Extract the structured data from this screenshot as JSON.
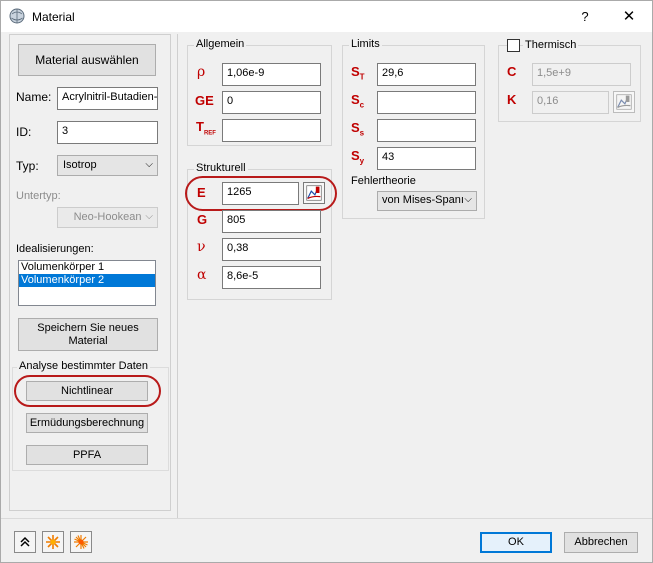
{
  "window": {
    "title": "Material",
    "help_label": "?",
    "close_label": "✕"
  },
  "left": {
    "select_material_label": "Material auswählen",
    "name_label": "Name:",
    "name_value": "Acrylnitril-Butadien-",
    "id_label": "ID:",
    "id_value": "3",
    "type_label": "Typ:",
    "type_value": "Isotrop",
    "subtype_label": "Untertyp:",
    "subtype_value": "Neo-Hookean",
    "idealizations_label": "Idealisierungen:",
    "idealizations": [
      "Volumenkörper 1",
      "Volumenkörper 2"
    ],
    "save_material_label": "Speichern Sie neues Material",
    "analysis_group_title": "Analyse bestimmter Daten",
    "nonlinear_label": "Nichtlinear",
    "fatigue_label": "Ermüdungsberechnung",
    "ppfa_label": "PPFA"
  },
  "allgemein": {
    "title": "Allgemein",
    "rho_symbol": "ρ",
    "rho_value": "1,06e-9",
    "ge_symbol": "GE",
    "ge_value": "0",
    "tref_symbol": "T",
    "tref_sub": "REF",
    "tref_value": ""
  },
  "strukturell": {
    "title": "Strukturell",
    "e_symbol": "E",
    "e_value": "1265",
    "g_symbol": "G",
    "g_value": "805",
    "nu_symbol": "ν",
    "nu_value": "0,38",
    "alpha_symbol": "α",
    "alpha_value": "8,6e-5"
  },
  "limits": {
    "title": "Limits",
    "st_symbol": "S",
    "st_sub": "T",
    "st_value": "29,6",
    "sc_symbol": "S",
    "sc_sub": "c",
    "sc_value": "",
    "ss_symbol": "S",
    "ss_sub": "s",
    "ss_value": "",
    "sy_symbol": "S",
    "sy_sub": "y",
    "sy_value": "43",
    "failure_theory_label": "Fehlertheorie",
    "failure_theory_value": "von Mises-Spanı"
  },
  "thermisch": {
    "title": "Thermisch",
    "checked": false,
    "c_symbol": "C",
    "c_value": "1,5e+9",
    "k_symbol": "K",
    "k_value": "0,16"
  },
  "footer": {
    "ok_label": "OK",
    "cancel_label": "Abbrechen"
  },
  "icons": {
    "app": "material-sphere-icon",
    "chart": "stress-strain-chart-icon",
    "collapse": "double-chevron-up-icon",
    "star1": "orange-star-icon",
    "star2": "orange-sparkle-icon"
  },
  "colors": {
    "symbol_red": "#c00000",
    "highlight_ring": "#b81a1a",
    "selection_blue": "#0078d7",
    "ok_border": "#0078d7"
  }
}
